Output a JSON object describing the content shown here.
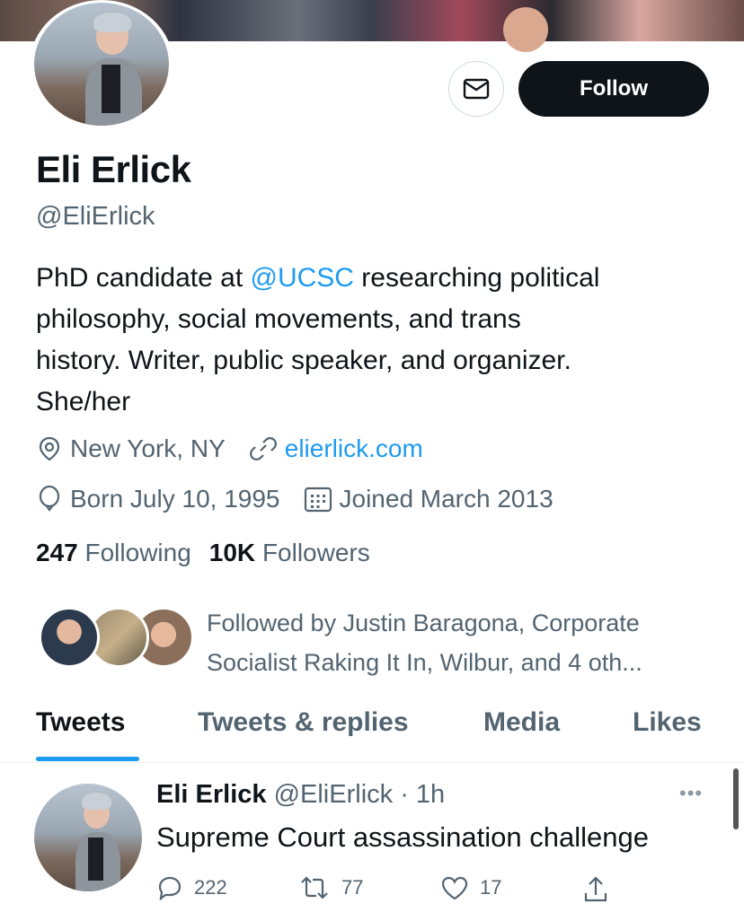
{
  "profile": {
    "name": "Eli Erlick",
    "handle": "@EliErlick",
    "follow_label": "Follow",
    "bio": {
      "line1_prefix": "PhD candidate at ",
      "line1_mention": "@UCSC",
      "line1_suffix": " researching political",
      "line2": "philosophy, social movements, and trans",
      "line3": "history. Writer, public speaker, and organizer.",
      "line4": "She/her"
    },
    "location": "New York, NY",
    "website": "elierlick.com",
    "born": "Born July 10, 1995",
    "joined": "Joined March 2013",
    "following_count": "247",
    "following_label": "Following",
    "followers_count": "10K",
    "followers_label": "Followers",
    "followed_by_line1": "Followed by Justin Baragona, Corporate",
    "followed_by_line2": "Socialist Raking It In, Wilbur, and 4 oth..."
  },
  "tabs": [
    "Tweets",
    "Tweets & replies",
    "Media",
    "Likes"
  ],
  "tweet": {
    "name": "Eli Erlick",
    "handle": "@EliErlick",
    "time": "· 1h",
    "text": "Supreme Court assassination challenge",
    "replies": "222",
    "retweets": "77",
    "likes": "17",
    "more": "•••"
  },
  "colors": {
    "accent": "#1d9bf0",
    "text": "#0f1419",
    "secondary": "#536471"
  },
  "icons": [
    "mail-icon",
    "location-icon",
    "link-icon",
    "birthday-icon",
    "calendar-icon",
    "reply-icon",
    "retweet-icon",
    "like-icon",
    "share-icon",
    "more-icon"
  ]
}
